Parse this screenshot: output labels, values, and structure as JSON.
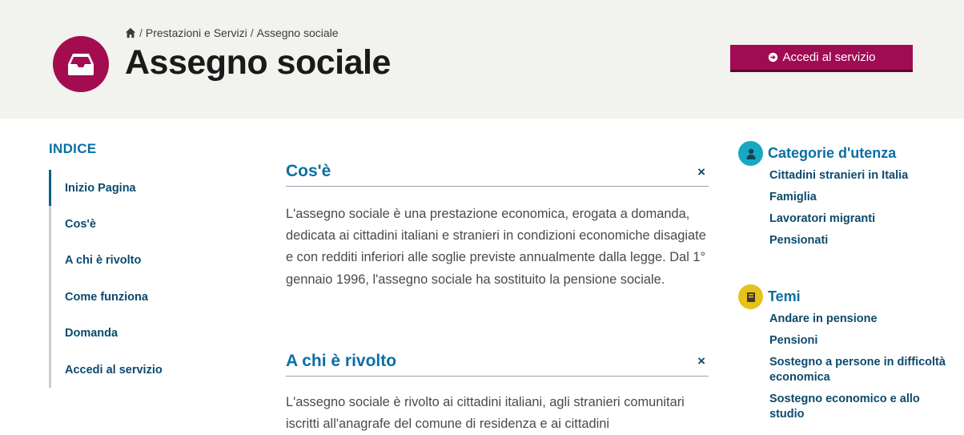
{
  "breadcrumb": {
    "items": [
      "Prestazioni e Servizi",
      "Assegno sociale"
    ],
    "separator": "/"
  },
  "page": {
    "title": "Assegno sociale",
    "icon": "inbox-tray-icon",
    "icon_color": "#a30d4f"
  },
  "access_button": {
    "label": "Accedi al servizio",
    "icon": "arrow-circle-right-icon",
    "color": "#a00c54"
  },
  "index": {
    "title": "INDICE",
    "items": [
      {
        "label": "Inizio Pagina",
        "active": true
      },
      {
        "label": "Cos'è"
      },
      {
        "label": "A chi è rivolto"
      },
      {
        "label": "Come funziona"
      },
      {
        "label": "Domanda"
      },
      {
        "label": "Accedi al servizio"
      }
    ]
  },
  "sections": [
    {
      "title": "Cos'è",
      "close": "×",
      "text": "L'assegno sociale è una prestazione economica, erogata a domanda, dedicata ai cittadini italiani e stranieri in condizioni economiche disagiate e con redditi inferiori alle soglie previste annualmente dalla legge. Dal 1° gennaio 1996, l'assegno sociale ha sostituito la pensione sociale."
    },
    {
      "title": "A chi è rivolto",
      "close": "×",
      "text": "L'assegno sociale è rivolto ai cittadini italiani, agli stranieri comunitari iscritti all'anagrafe del comune di residenza e ai cittadini"
    }
  ],
  "sidebar": {
    "categories": {
      "title": "Categorie d'utenza",
      "icon": "user-icon",
      "badge_color": "#17a9c4",
      "links": [
        "Cittadini stranieri in Italia",
        "Famiglia",
        "Lavoratori migranti",
        "Pensionati"
      ]
    },
    "themes": {
      "title": "Temi",
      "icon": "book-icon",
      "badge_color": "#e6c21b",
      "links": [
        "Andare in pensione",
        "Pensioni",
        "Sostegno a persone in difficoltà economica",
        "Sostegno economico e allo studio"
      ]
    }
  }
}
